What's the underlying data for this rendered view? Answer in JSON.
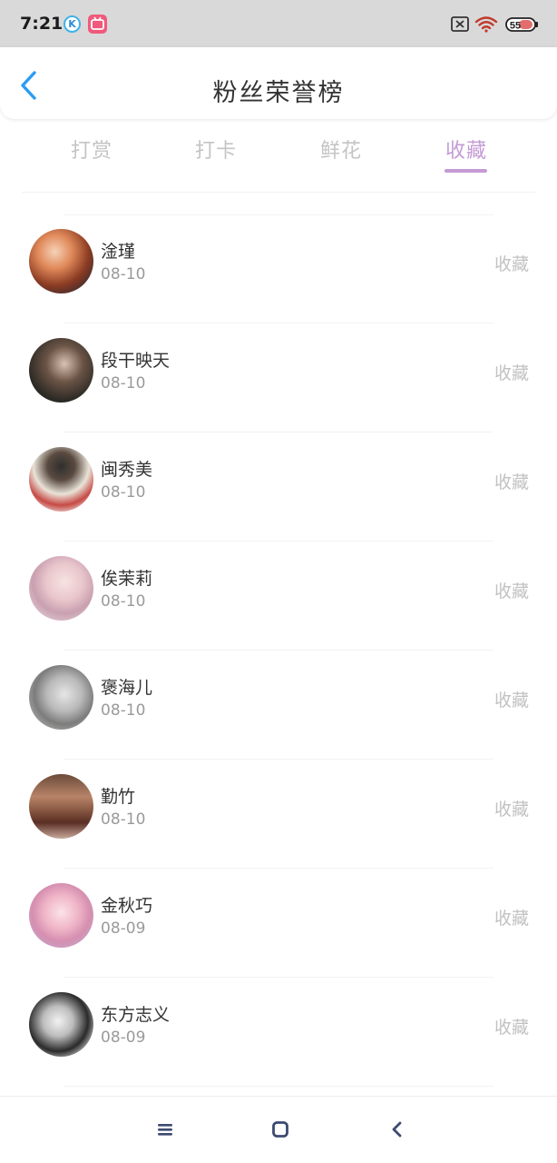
{
  "status_bar": {
    "time": "7:21",
    "app_k": "K",
    "battery": "55"
  },
  "header": {
    "title": "粉丝荣誉榜"
  },
  "tabs": [
    {
      "label": "打赏",
      "active": false
    },
    {
      "label": "打卡",
      "active": false
    },
    {
      "label": "鲜花",
      "active": false
    },
    {
      "label": "收藏",
      "active": true
    }
  ],
  "colors": {
    "accent": "#c49bd5",
    "back_arrow": "#2a9df4"
  },
  "fans": [
    {
      "name": "淦瑾",
      "date": "08-10",
      "type": "收藏"
    },
    {
      "name": "段干映天",
      "date": "08-10",
      "type": "收藏"
    },
    {
      "name": "闽秀美",
      "date": "08-10",
      "type": "收藏"
    },
    {
      "name": "俟茉莉",
      "date": "08-10",
      "type": "收藏"
    },
    {
      "name": "褒海儿",
      "date": "08-10",
      "type": "收藏"
    },
    {
      "name": "勤竹",
      "date": "08-10",
      "type": "收藏"
    },
    {
      "name": "金秋巧",
      "date": "08-09",
      "type": "收藏"
    },
    {
      "name": "东方志义",
      "date": "08-09",
      "type": "收藏"
    }
  ]
}
